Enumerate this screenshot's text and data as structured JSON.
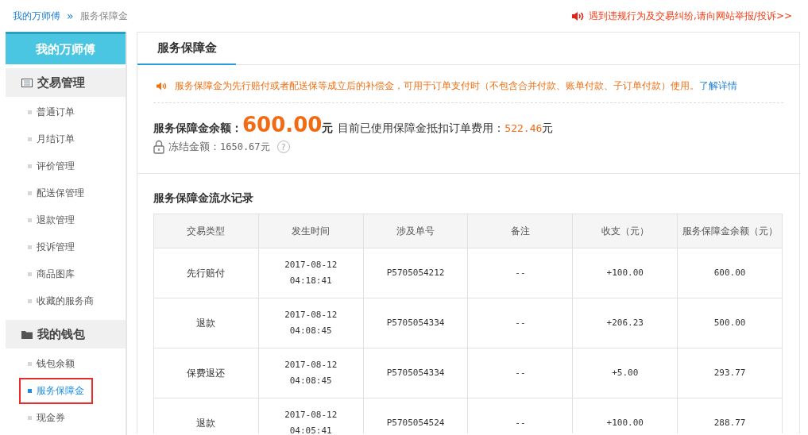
{
  "breadcrumb": {
    "items": [
      {
        "label": "我的万师傅",
        "kind": "link"
      },
      {
        "label": "服务保障金",
        "kind": "current"
      }
    ],
    "separator": "»"
  },
  "report_link": "遇到违规行为及交易纠纷,请向网站举报/投诉>>",
  "sidebar": {
    "title": "我的万师傅",
    "groups": [
      {
        "label": "交易管理",
        "kind": "list",
        "items": [
          {
            "label": "普通订单",
            "selected": false
          },
          {
            "label": "月结订单",
            "selected": false
          },
          {
            "label": "评价管理",
            "selected": false
          },
          {
            "label": "配送保管理",
            "selected": false
          },
          {
            "label": "退款管理",
            "selected": false
          },
          {
            "label": "投诉管理",
            "selected": false
          },
          {
            "label": "商品图库",
            "selected": false
          },
          {
            "label": "收藏的服务商",
            "selected": false
          }
        ]
      },
      {
        "label": "我的钱包",
        "kind": "folder",
        "items": [
          {
            "label": "钱包余额",
            "selected": false
          },
          {
            "label": "服务保障金",
            "selected": true
          },
          {
            "label": "现金券",
            "selected": false
          }
        ]
      }
    ]
  },
  "main": {
    "tabs": [
      {
        "label": "服务保障金",
        "selected": true
      }
    ],
    "notice": {
      "text": "服务保障金为先行赔付或者配送保等成立后的补偿金，可用于订单支付时（不包含合并付款、账单付款、子订单付款）使用。",
      "link": "了解详情"
    },
    "balance": {
      "label": "服务保障金余额：",
      "amount": "600.00",
      "unit": "元",
      "used_label": "目前已使用保障金抵扣订单费用：",
      "used_amount": "522.46",
      "used_unit": "元"
    },
    "frozen": {
      "label": "冻结金额：",
      "amount": "1650.67元",
      "help": "?"
    },
    "records_title": "服务保障金流水记录",
    "table": {
      "columns": [
        "交易类型",
        "发生时间",
        "涉及单号",
        "备注",
        "收支（元）",
        "服务保障金余额（元）"
      ],
      "rows": [
        [
          "先行赔付",
          "2017-08-12 04:18:41",
          "P5705054212",
          "--",
          "+100.00",
          "600.00"
        ],
        [
          "退款",
          "2017-08-12 04:08:45",
          "P5705054334",
          "--",
          "+206.23",
          "500.00"
        ],
        [
          "保费退还",
          "2017-08-12 04:08:45",
          "P5705054334",
          "--",
          "+5.00",
          "293.77"
        ],
        [
          "退款",
          "2017-08-12 04:05:41",
          "P5705054524",
          "--",
          "+100.00",
          "288.77"
        ]
      ]
    }
  }
}
